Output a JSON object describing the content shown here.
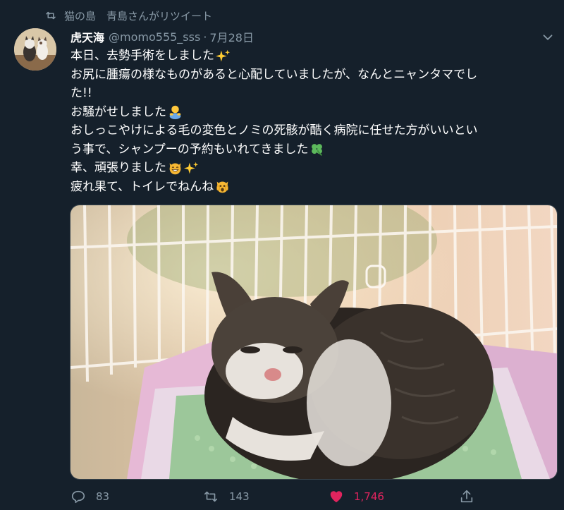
{
  "retweet_context": {
    "icon": "retweet-icon",
    "text": "猫の島　青島さんがリツイート"
  },
  "tweet": {
    "author": {
      "display_name": "虎天海",
      "handle": "@momo555_sss",
      "separator": "·",
      "date": "7月28日"
    },
    "lines": [
      {
        "text": "本日、去勢手術をしました",
        "emoji": [
          "sparkles-icon"
        ]
      },
      {
        "text": "お尻に腫瘍の様なものがあると心配していましたが、なんとニャンタマでし",
        "emoji": []
      },
      {
        "text": "た!!",
        "emoji": []
      },
      {
        "text": "お騒がせしました",
        "emoji": [
          "person-bowing-icon"
        ]
      },
      {
        "text": "おしっこやけによる毛の変色とノミの死骸が酷く病院に任せた方がいいとい",
        "emoji": []
      },
      {
        "text": "う事で、シャンプーの予約もいれてきました",
        "emoji": [
          "four-leaf-clover-icon"
        ]
      },
      {
        "text": "幸、頑張りました",
        "emoji": [
          "grinning-cat-icon",
          "sparkles-icon"
        ]
      },
      {
        "text": "疲れ果て、トイレでねんね",
        "emoji": [
          "weary-cat-icon"
        ]
      }
    ],
    "actions": {
      "reply": {
        "icon": "reply-icon",
        "count": "83"
      },
      "retweet": {
        "icon": "retweet-icon",
        "count": "143"
      },
      "like": {
        "icon": "heart-icon",
        "count": "1,746",
        "liked": true
      },
      "share": {
        "icon": "share-icon"
      }
    }
  },
  "colors": {
    "background": "#15202b",
    "secondary_text": "#8899a6",
    "like_red": "#e0245e",
    "border": "#38444d"
  }
}
